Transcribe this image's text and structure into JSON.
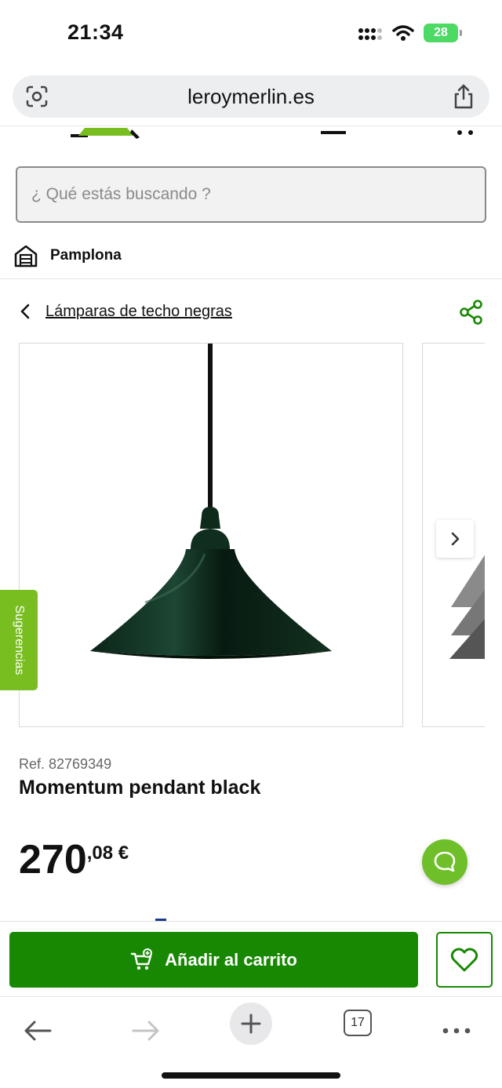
{
  "status": {
    "time": "21:34",
    "battery": "28"
  },
  "browser": {
    "url": "leroymerlin.es",
    "tabs_count": "17"
  },
  "search": {
    "placeholder": "¿ Qué estás buscando ?"
  },
  "store": {
    "name": "Pamplona"
  },
  "breadcrumb": {
    "label": "Lámparas de techo negras"
  },
  "side_tab": {
    "label": "Sugerencias"
  },
  "product": {
    "ref": "Ref. 82769349",
    "title": "Momentum pendant black",
    "price_int": "270",
    "price_dec": ",08 €"
  },
  "actions": {
    "add_to_cart": "Añadir al carrito"
  },
  "colors": {
    "brand_green": "#188803",
    "accent_green": "#78be20"
  },
  "icons": [
    "camera-search-icon",
    "share-icon",
    "home-store-icon",
    "chevron-left-icon",
    "share-nodes-icon",
    "chevron-right-icon",
    "chat-icon",
    "cart-icon",
    "heart-icon",
    "back-arrow-icon",
    "forward-arrow-icon",
    "plus-icon",
    "more-icon"
  ]
}
